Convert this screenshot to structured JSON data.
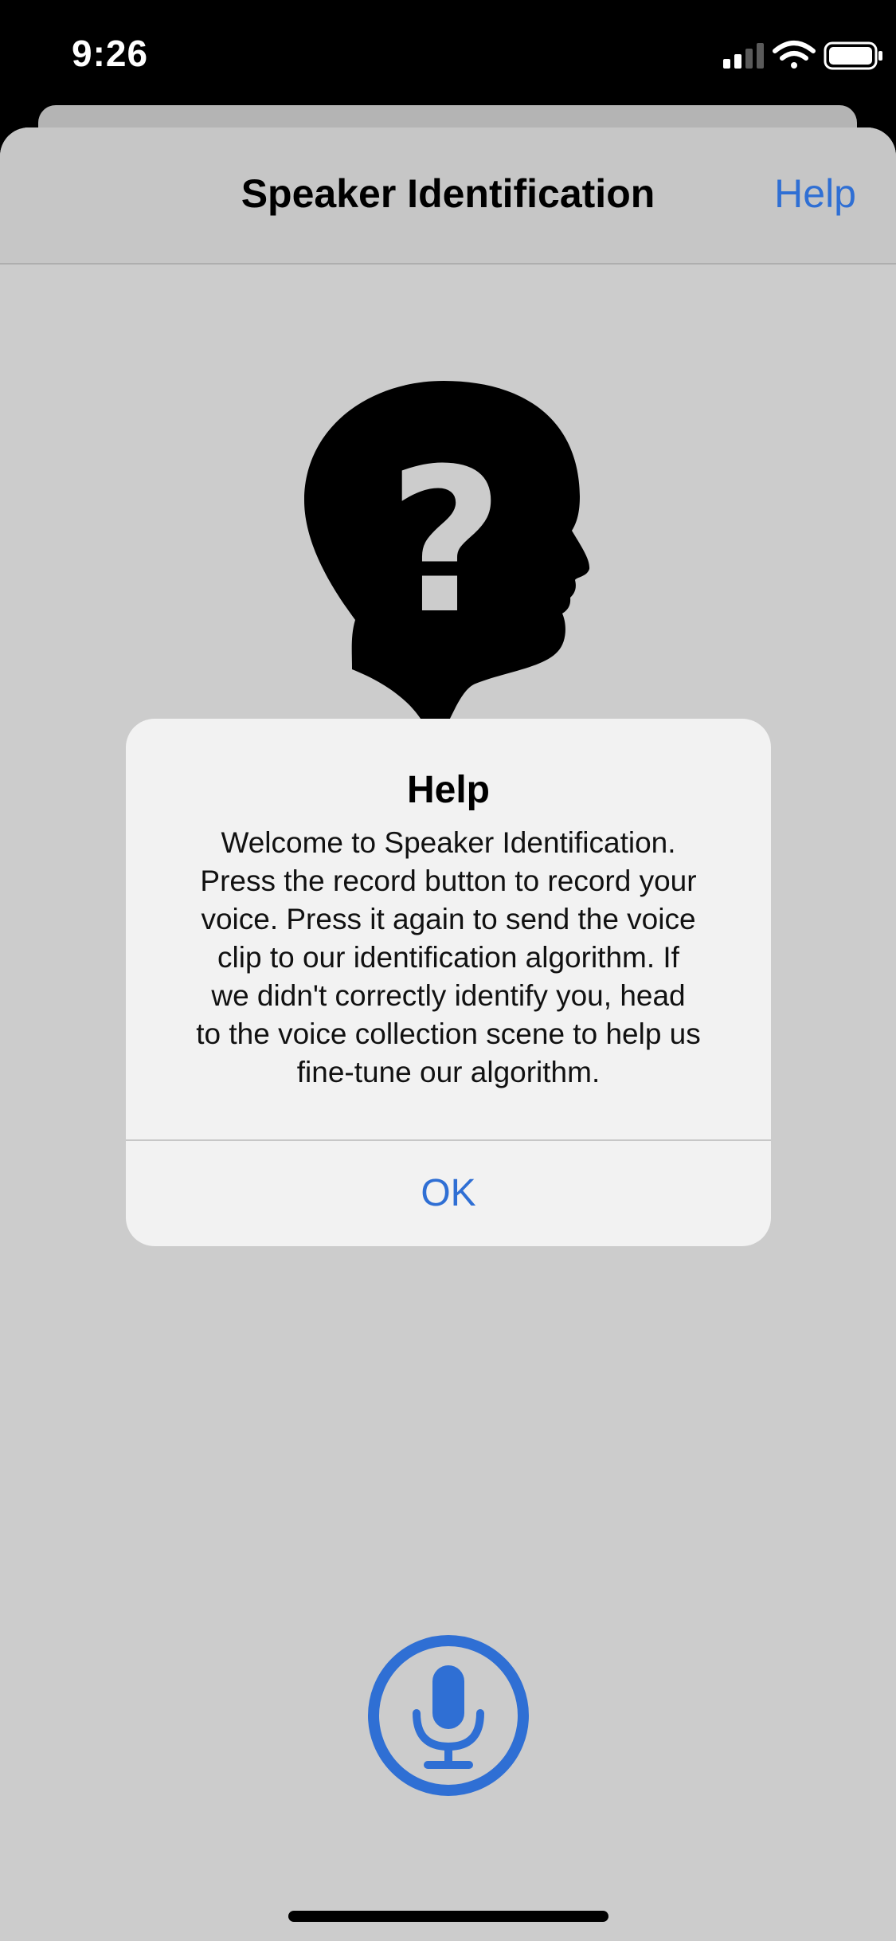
{
  "status_bar": {
    "time": "9:26",
    "icons": [
      "cellular-signal-icon",
      "wifi-icon",
      "battery-icon"
    ]
  },
  "nav": {
    "title": "Speaker Identification",
    "help_label": "Help"
  },
  "hero": {
    "icon": "head-question-icon",
    "glyph": "?"
  },
  "alert": {
    "title": "Help",
    "message_lines": [
      "Welcome to Speaker Identification.",
      "Press the record button to record your",
      "voice. Press it again to send the voice",
      "clip to our identification algorithm. If",
      "we didn't correctly identify you, head",
      "to the voice collection scene to help us",
      "fine-tune our algorithm."
    ],
    "ok_label": "OK"
  },
  "record": {
    "icon": "microphone-icon"
  },
  "colors": {
    "accent": "#2f6fd4",
    "background": "#cccccc",
    "alert_background": "#f2f2f2"
  }
}
